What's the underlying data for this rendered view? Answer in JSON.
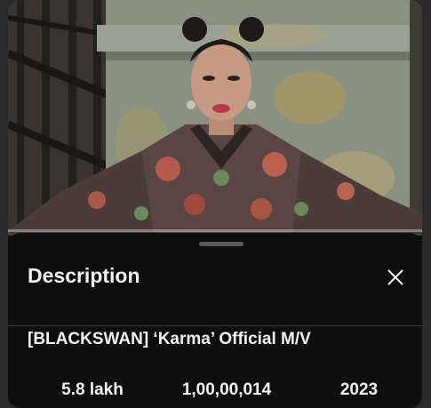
{
  "player": {
    "progress": 0
  },
  "description_sheet": {
    "heading": "Description",
    "close_icon": "close-icon",
    "video_title": "[BLACKSWAN] ‘Karma’ Official M/V",
    "stats": {
      "likes": "5.8 lakh",
      "views": "1,00,00,014",
      "year": "2023"
    }
  },
  "colors": {
    "sheet_background": "#0f0f0f",
    "text": "#f1f1f1",
    "accent": "#ff0000"
  }
}
